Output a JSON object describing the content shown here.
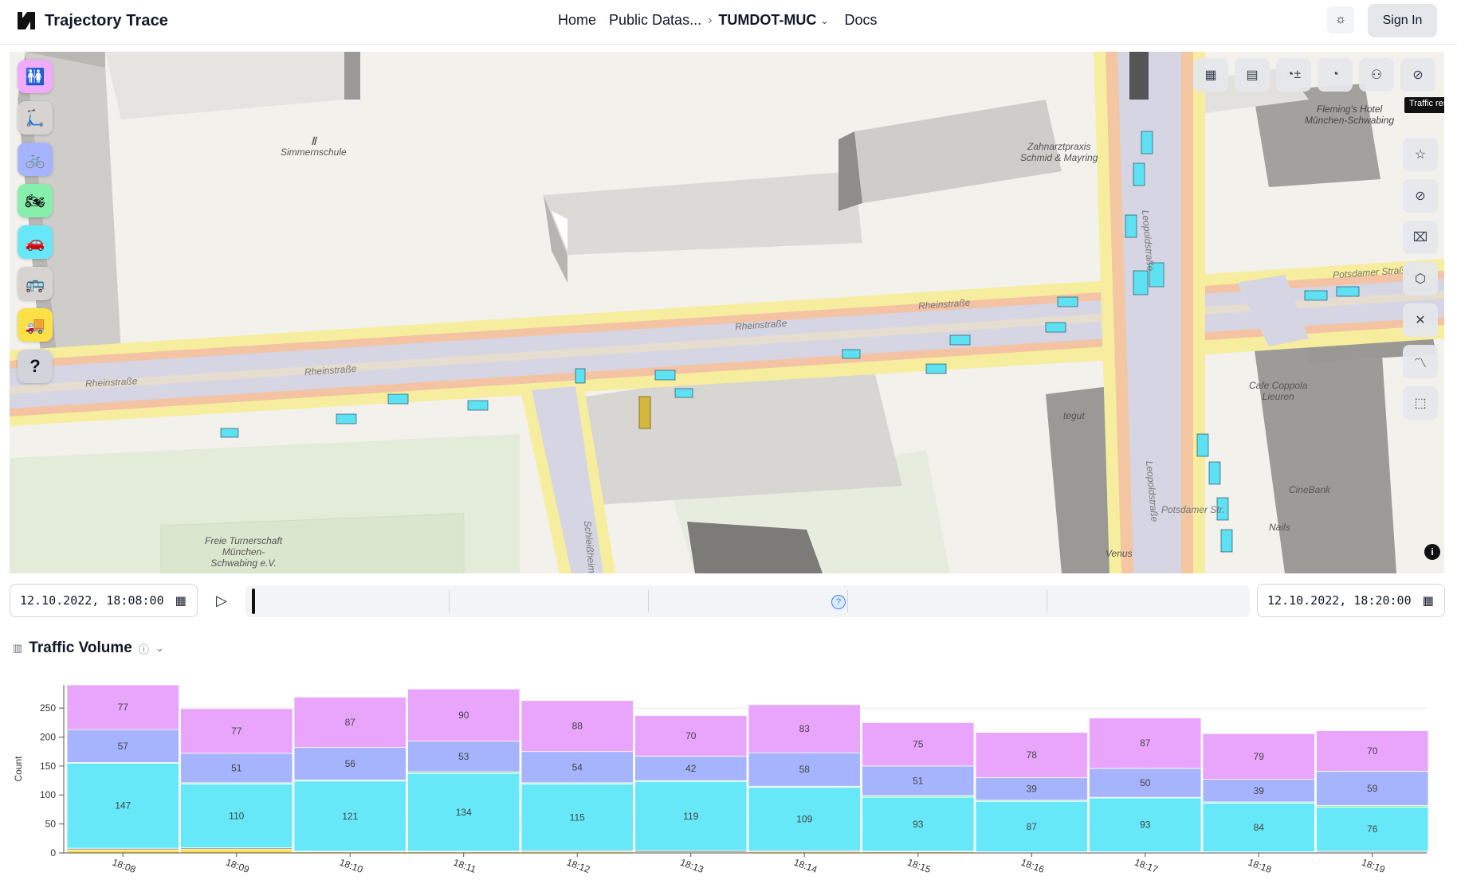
{
  "header": {
    "app_title": "Trajectory Trace",
    "nav": {
      "home": "Home",
      "public_datasets": "Public Datas...",
      "breadcrumb_sep": "›",
      "current_dataset": "TUMDOT-MUC",
      "docs": "Docs"
    },
    "sign_in": "Sign In"
  },
  "map": {
    "tooltip": "Traffic resea",
    "labels": {
      "school": "Simmernschule",
      "dentist": "Zahnarztpraxis\nSchmid & Mayring",
      "hotel": "Fleming's Hotel\nMünchen-Schwabing",
      "club": "Freie Turnerschaft\nMünchen-\nSchwabing e.V.",
      "cafe": "Cafe Coppola\nLieuren",
      "cinebank": "CineBank",
      "nails": "Nails",
      "tegut": "tegut",
      "venus": "Venus"
    },
    "streets": {
      "rhein1": "Rheinstraße",
      "rhein2": "Rheinstraße",
      "rhein3": "Rheinstraße",
      "rhein4": "Rheinstraße",
      "potsdamer1": "Potsdamer Straße",
      "potsdamer2": "Potsdamer Str.",
      "leopold1": "Leopoldstraße",
      "leopold2": "Leopoldstraße",
      "schlei": "Schleißheimer"
    },
    "left_tools": [
      {
        "name": "pedestrian",
        "glyph": "🚻",
        "bg": "#f0abfc"
      },
      {
        "name": "scooter",
        "glyph": "🛴",
        "bg": "#d6d3d1"
      },
      {
        "name": "bicycle",
        "glyph": "🚲",
        "bg": "#a5b4fc"
      },
      {
        "name": "motorcycle",
        "glyph": "🏍",
        "bg": "#86efac"
      },
      {
        "name": "car",
        "glyph": "🚗",
        "bg": "#67e8f9"
      },
      {
        "name": "bus",
        "glyph": "🚌",
        "bg": "#d6d3d1"
      },
      {
        "name": "truck",
        "glyph": "🚚",
        "bg": "#fde047"
      },
      {
        "name": "help",
        "glyph": "?",
        "bg": "#d1d5db"
      }
    ]
  },
  "timeline": {
    "start": "12.10.2022, 18:08:00",
    "end": "12.10.2022, 18:20:00",
    "help_glyph": "?"
  },
  "chart_section": {
    "title": "Traffic Volume"
  },
  "chart_data": {
    "type": "bar",
    "stacked": true,
    "categories": [
      "18:08",
      "18:09",
      "18:10",
      "18:11",
      "18:12",
      "18:13",
      "18:14",
      "18:15",
      "18:16",
      "18:17",
      "18:18",
      "18:19"
    ],
    "ylabel": "Count",
    "xlabel": "",
    "ylim": [
      0,
      290
    ],
    "yticks": [
      0,
      50,
      100,
      150,
      200,
      250
    ],
    "grid": true,
    "series": [
      {
        "key": "truck",
        "color": "#fde047",
        "values": [
          5,
          6,
          2,
          2,
          2,
          1,
          2,
          2,
          1,
          1,
          1,
          1
        ]
      },
      {
        "key": "bus",
        "color": "#a8a29e",
        "values": [
          3,
          3,
          1,
          1,
          2,
          3,
          2,
          1,
          1,
          1,
          1,
          2
        ]
      },
      {
        "key": "car",
        "color": "#67e8f9",
        "values": [
          147,
          110,
          121,
          134,
          115,
          119,
          109,
          93,
          87,
          93,
          84,
          76
        ]
      },
      {
        "key": "motorcycle",
        "color": "#86efac",
        "values": [
          1,
          2,
          2,
          3,
          2,
          2,
          2,
          3,
          2,
          1,
          2,
          3
        ]
      },
      {
        "key": "bicycle",
        "color": "#a5b4fc",
        "values": [
          57,
          51,
          56,
          53,
          54,
          42,
          58,
          51,
          39,
          50,
          39,
          59
        ]
      },
      {
        "key": "pedestrian",
        "color": "#e9a5fb",
        "values": [
          77,
          77,
          87,
          90,
          88,
          70,
          83,
          75,
          78,
          87,
          79,
          70
        ]
      }
    ],
    "labeled_series": [
      "car",
      "bicycle",
      "pedestrian"
    ]
  }
}
